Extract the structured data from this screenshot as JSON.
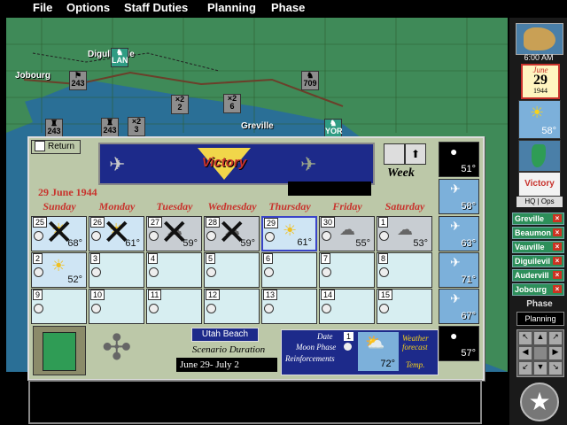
{
  "menu": [
    "File",
    "Options",
    "Staff Duties",
    "Planning",
    "Phase"
  ],
  "map": {
    "towns": [
      "Digulleville",
      "Jobourg",
      "Greville"
    ],
    "units": [
      {
        "label": "243",
        "icon": "flag"
      },
      {
        "label": "LAN",
        "icon": "infantry"
      },
      {
        "label": "2",
        "icon": "x2"
      },
      {
        "label": "6",
        "icon": "x2"
      },
      {
        "label": "243",
        "icon": "fort"
      },
      {
        "label": "243",
        "icon": "fort"
      },
      {
        "label": "3",
        "icon": "x2"
      },
      {
        "label": "709",
        "icon": "infantry"
      },
      {
        "label": "YOR",
        "icon": "infantry"
      }
    ]
  },
  "right_panel": {
    "time": "6:00 AM",
    "month": "June",
    "day": "29",
    "year": "1944",
    "temp": "58°",
    "victory_label": "Victory",
    "hq_label": "HQ",
    "ops_label": "Ops",
    "locations": [
      "Greville",
      "Beaumon",
      "Vauville",
      "Diguilevil",
      "Audervill",
      "Jobourg"
    ],
    "phase_label": "Phase",
    "phase_value": "Planning"
  },
  "dialog": {
    "return_label": "Return",
    "banner_title": "Victory",
    "week_label": "Week",
    "current_date": "29 June 1944",
    "days": [
      "Sunday",
      "Monday",
      "Tuesday",
      "Wednesday",
      "Thursday",
      "Friday",
      "Saturday"
    ],
    "row1": [
      {
        "num": "25",
        "temp": "68°",
        "past": true,
        "wx": "sunny"
      },
      {
        "num": "26",
        "temp": "61°",
        "past": true,
        "wx": "sunny"
      },
      {
        "num": "27",
        "temp": "59°",
        "past": true,
        "wx": "cloudy"
      },
      {
        "num": "28",
        "temp": "59°",
        "past": true,
        "wx": "cloudy"
      },
      {
        "num": "29",
        "temp": "61°",
        "past": false,
        "wx": "sunny",
        "today": true
      },
      {
        "num": "30",
        "temp": "55°",
        "past": false,
        "wx": "cloudy"
      },
      {
        "num": "1",
        "temp": "53°",
        "past": false,
        "wx": "cloudy"
      }
    ],
    "row2": [
      {
        "num": "2",
        "temp": "52°",
        "wx": "sunny"
      },
      {
        "num": "3"
      },
      {
        "num": "4"
      },
      {
        "num": "5"
      },
      {
        "num": "6"
      },
      {
        "num": "7"
      },
      {
        "num": "8"
      }
    ],
    "row3": [
      {
        "num": "9"
      },
      {
        "num": "10"
      },
      {
        "num": "11"
      },
      {
        "num": "12"
      },
      {
        "num": "13"
      },
      {
        "num": "14"
      },
      {
        "num": "15"
      }
    ],
    "side_column_temps": [
      "51°",
      "58°",
      "63°",
      "71°",
      "67°",
      "57°"
    ],
    "beach_label": "Utah Beach",
    "duration_label": "Scenario Duration",
    "duration_value": "June 29-  July 2",
    "legend": {
      "date_label": "Date",
      "date_value": "1",
      "moon_label": "Moon Phase",
      "reinf_label": "Reinforcements",
      "temp_value": "72°",
      "weather_label": "Weather forecast",
      "temp_label": "Temp."
    }
  },
  "colors": {
    "map_sea": "#2a6f96",
    "map_land": "#3f8a58",
    "dialog_bg": "#bcc8a8",
    "day_red": "#c8322c"
  }
}
